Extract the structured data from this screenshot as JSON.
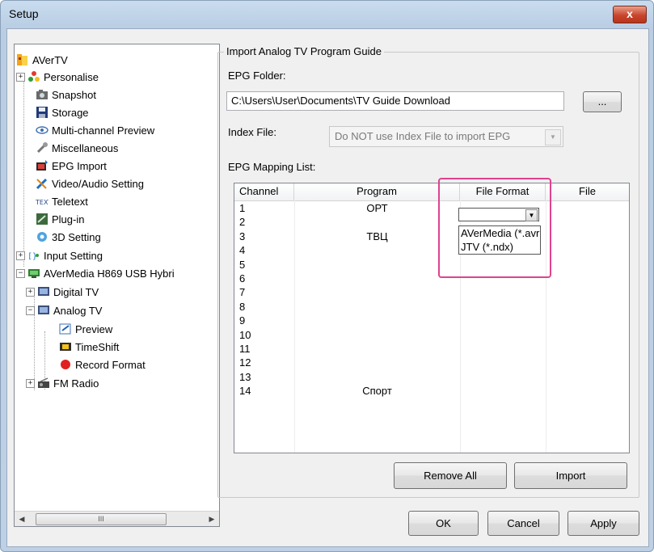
{
  "window": {
    "title": "Setup",
    "close_label": "x"
  },
  "tree": {
    "items": [
      {
        "label": "AVerTV",
        "icon": "avertv-logo-icon"
      },
      {
        "label": "Personalise",
        "icon": "personalise-icon"
      },
      {
        "label": "Snapshot",
        "icon": "camera-icon"
      },
      {
        "label": "Storage",
        "icon": "floppy-disk-icon"
      },
      {
        "label": "Multi-channel Preview",
        "icon": "eye-icon"
      },
      {
        "label": "Miscellaneous",
        "icon": "wrench-icon"
      },
      {
        "label": "EPG Import",
        "icon": "epg-import-icon"
      },
      {
        "label": "Video/Audio Setting",
        "icon": "tools-icon"
      },
      {
        "label": "Teletext",
        "icon": "teletext-icon"
      },
      {
        "label": "Plug-in",
        "icon": "plugin-icon"
      },
      {
        "label": "3D Setting",
        "icon": "3d-gear-icon"
      },
      {
        "label": "Input Setting",
        "icon": "input-icon"
      },
      {
        "label": "AVerMedia H869 USB Hybri",
        "icon": "tv-tuner-icon"
      },
      {
        "label": "Digital TV",
        "icon": "digital-tv-icon"
      },
      {
        "label": "Analog TV",
        "icon": "analog-tv-icon"
      },
      {
        "label": "Preview",
        "icon": "preview-icon"
      },
      {
        "label": "TimeShift",
        "icon": "timeshift-icon"
      },
      {
        "label": "Record Format",
        "icon": "record-icon"
      },
      {
        "label": "FM Radio",
        "icon": "fm-radio-icon"
      }
    ],
    "scroll_thumb": "III"
  },
  "group": {
    "title": "Import Analog TV Program Guide",
    "epg_folder_label": "EPG Folder:",
    "epg_folder_value": "C:\\Users\\User\\Documents\\TV Guide Download",
    "browse_label": "...",
    "index_file_label": "Index File:",
    "index_file_value": "Do NOT use Index File to import EPG",
    "mapping_list_label": "EPG Mapping List:"
  },
  "list": {
    "columns": [
      "Channel",
      "Program",
      "File Format",
      "File"
    ],
    "rows": [
      {
        "channel": "1",
        "program": "ОРТ"
      },
      {
        "channel": "2",
        "program": ""
      },
      {
        "channel": "3",
        "program": "ТВЦ"
      },
      {
        "channel": "4",
        "program": ""
      },
      {
        "channel": "5",
        "program": ""
      },
      {
        "channel": "6",
        "program": ""
      },
      {
        "channel": "7",
        "program": ""
      },
      {
        "channel": "8",
        "program": ""
      },
      {
        "channel": "9",
        "program": ""
      },
      {
        "channel": "10",
        "program": ""
      },
      {
        "channel": "11",
        "program": ""
      },
      {
        "channel": "12",
        "program": ""
      },
      {
        "channel": "13",
        "program": ""
      },
      {
        "channel": "14",
        "program": "Спорт"
      }
    ],
    "format_dropdown": {
      "selected": "",
      "options": [
        "AVerMedia (*.avr",
        "JTV (*.ndx)"
      ]
    }
  },
  "buttons": {
    "remove_all": "Remove All",
    "import": "Import",
    "ok": "OK",
    "cancel": "Cancel",
    "apply": "Apply"
  },
  "colors": {
    "highlight": "#e0428f"
  }
}
